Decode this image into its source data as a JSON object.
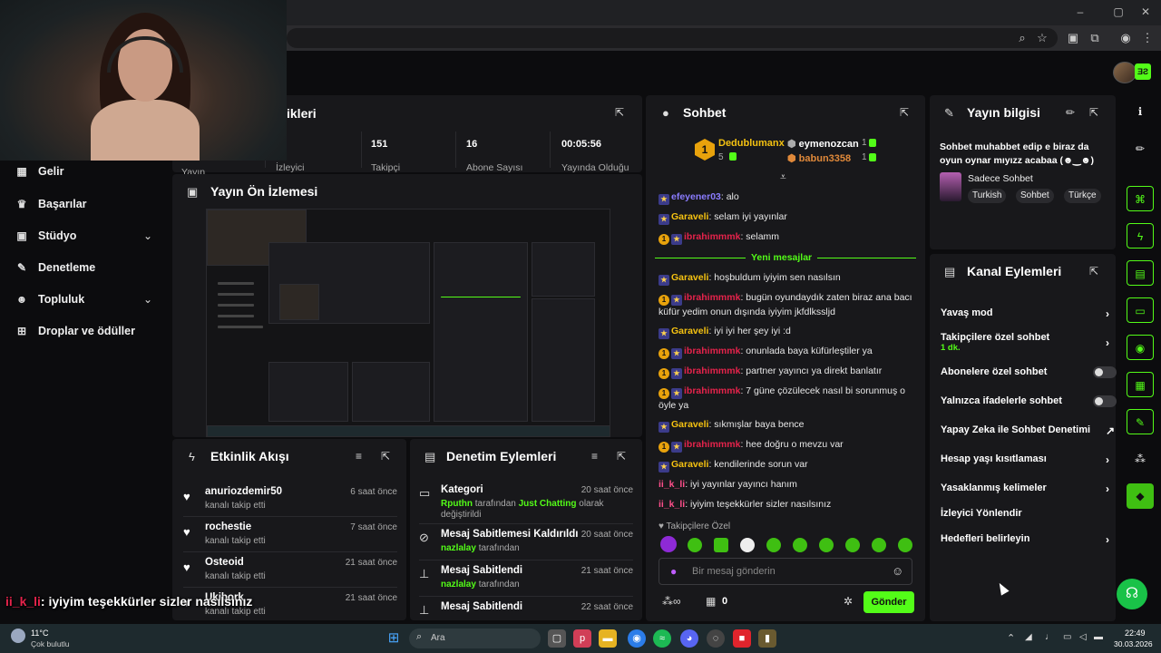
{
  "browser": {
    "window_controls": [
      "–",
      "▢",
      "✕"
    ]
  },
  "sidebar": {
    "items": [
      {
        "label": "Gelir",
        "icon": "dollar-icon"
      },
      {
        "label": "Başarılar",
        "icon": "trophy-icon"
      },
      {
        "label": "Stüdyo",
        "icon": "studio-icon"
      },
      {
        "label": "Denetleme",
        "icon": "wrench-icon"
      },
      {
        "label": "Topluluk",
        "icon": "community-icon"
      },
      {
        "label": "Droplar ve ödüller",
        "icon": "gift-icon"
      }
    ]
  },
  "stats": {
    "title_fragment": "ikleri",
    "values": [
      "151",
      "16",
      "00:05:56"
    ],
    "labels": [
      "Yayın",
      "İzleyici",
      "Takipçi",
      "Abone Sayısı",
      "Yayında Olduğu"
    ]
  },
  "preview": {
    "title": "Yayın Ön İzlemesi"
  },
  "activity": {
    "title": "Etkinlik Akışı",
    "items": [
      {
        "name": "anuriozdemir50",
        "sub": "kanalı takip etti",
        "time": "6 saat önce"
      },
      {
        "name": "rochestie",
        "sub": "kanalı takip etti",
        "time": "7 saat önce"
      },
      {
        "name": "Osteoid",
        "sub": "kanalı takip etti",
        "time": "21 saat önce"
      },
      {
        "name": "Ukibork",
        "sub": "kanalı takip etti",
        "time": "21 saat önce"
      }
    ]
  },
  "overlay_caption": {
    "user": "ii_k_li",
    "text": ": iyiyim teşekkürler sizler nasılsınız"
  },
  "moderation": {
    "title": "Denetim Eylemleri",
    "items": [
      {
        "title": "Kategori",
        "time": "20 saat önce",
        "actor": "Rputhn",
        "mid": " tarafından ",
        "target": "Just Chatting",
        "rest": " olarak değiştirildi"
      },
      {
        "title": "Mesaj Sabitlemesi Kaldırıldı",
        "time": "20 saat önce",
        "actor": "nazlalay",
        "rest": " tarafından"
      },
      {
        "title": "Mesaj Sabitlendi",
        "time": "21 saat önce",
        "actor": "nazlalay",
        "rest": " tarafından"
      },
      {
        "title": "Mesaj Sabitlendi",
        "time": "22 saat önce"
      }
    ]
  },
  "chat": {
    "title": "Sohbet",
    "top_gifters": [
      {
        "rank": "1",
        "name": "Dedublumanx",
        "count": "5"
      },
      {
        "name": "eymenozcan",
        "count": "1"
      },
      {
        "name": "babun3358",
        "count": "1"
      }
    ],
    "new_messages_label": "Yeni mesajlar",
    "messages": [
      {
        "user": "efeyener03",
        "text": ": alo",
        "color": "u-purple"
      },
      {
        "user": "Garaveli",
        "text": ": selam iyi yayınlar",
        "color": "u-yellow"
      },
      {
        "user": "ibrahimmmk",
        "text": ": selamm",
        "color": "u-red"
      },
      {
        "user": "Garaveli",
        "text": ": hoşbuldum iyiyim sen nasılsın",
        "color": "u-yellow"
      },
      {
        "user": "ibrahimmmk",
        "text": ": bugün oyundaydık zaten biraz ana bacı küfür yedim onun dışında iyiyim jkfdlkssljd",
        "color": "u-red"
      },
      {
        "user": "Garaveli",
        "text": ": iyi iyi her şey iyi :d",
        "color": "u-yellow"
      },
      {
        "user": "ibrahimmmk",
        "text": ": onunlada baya küfürleştiler ya",
        "color": "u-red"
      },
      {
        "user": "ibrahimmmk",
        "text": ": partner yayıncı ya direkt banlatır",
        "color": "u-red"
      },
      {
        "user": "ibrahimmmk",
        "text": ": 7 güne çözülecek nasıl bi sorunmuş o öyle ya",
        "color": "u-red"
      },
      {
        "user": "Garaveli",
        "text": ": sıkmışlar baya bence",
        "color": "u-yellow"
      },
      {
        "user": "ibrahimmmk",
        "text": ": hee doğru o mevzu var",
        "color": "u-red"
      },
      {
        "user": "Garaveli",
        "text": ": kendilerinde sorun var",
        "color": "u-yellow"
      },
      {
        "user": "ii_k_li",
        "text": ": iyi yayınlar yayıncı hanım",
        "color": "u-pink"
      },
      {
        "user": "ii_k_li",
        "text": ": iyiyim teşekkürler sizler nasılsınız",
        "color": "u-pink"
      }
    ],
    "followers_only": "Takipçilere Özel",
    "input_placeholder": "Bir mesaj gönderin",
    "points": "0",
    "send_label": "Gönder"
  },
  "stream_info": {
    "title": "Yayın bilgisi",
    "stream_title": "Sohbet muhabbet edip e biraz da oyun oynar mıyızz acabaa (☻‿☻)",
    "category": "Sadece Sohbet",
    "tags": [
      "Turkish",
      "Sohbet",
      "Türkçe"
    ]
  },
  "channel_actions": {
    "title": "Kanal Eylemleri",
    "items": [
      {
        "label": "Yavaş mod",
        "control": "chevron"
      },
      {
        "label": "Takipçilere özel sohbet",
        "sub": "1 dk.",
        "control": "chevron"
      },
      {
        "label": "Abonelere özel sohbet",
        "control": "toggle"
      },
      {
        "label": "Yalnızca ifadelerle sohbet",
        "control": "toggle"
      },
      {
        "label": "Yapay Zeka ile Sohbet Denetimi",
        "control": "external"
      },
      {
        "label": "Hesap yaşı kısıtlaması",
        "control": "chevron"
      },
      {
        "label": "Yasaklanmış kelimeler",
        "control": "chevron"
      },
      {
        "label": "İzleyici Yönlendir",
        "control": "none"
      },
      {
        "label": "Hedefleri belirleyin",
        "control": "chevron"
      }
    ]
  },
  "taskbar": {
    "weather_temp": "11°C",
    "weather_desc": "Çok bulutlu",
    "search_placeholder": "Ara",
    "time": "22:49",
    "date": "30.03.2026"
  },
  "colors": {
    "accent": "#53fc18",
    "panel": "#18181b",
    "background": "#0c0c0e"
  }
}
